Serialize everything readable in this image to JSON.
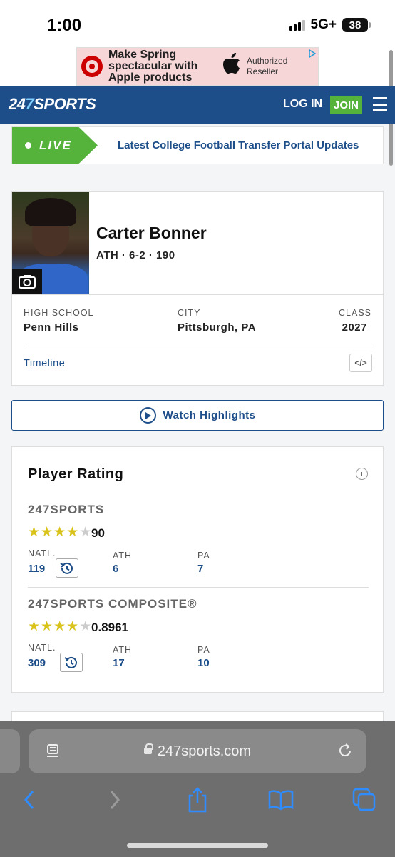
{
  "status_bar": {
    "time": "1:00",
    "network": "5G+",
    "battery": "38"
  },
  "ad": {
    "headline": "Make Spring spectacular with Apple products",
    "reseller": "Authorized Reseller",
    "choice_icon": "ad-choices-icon",
    "brand_color": "#cc0000"
  },
  "header": {
    "logo_prefix": "24",
    "logo_seven": "7",
    "logo_suffix": "SPORTS",
    "login": "LOG IN",
    "join": "JOIN",
    "menu_icon": "hamburger-icon",
    "color": "#1d4e89"
  },
  "live": {
    "badge": "LIVE",
    "headline": "Latest College Football Transfer Portal Updates",
    "color": "#55b33b"
  },
  "player": {
    "name": "Carter Bonner",
    "meta": "ATH · 6-2 · 190",
    "high_school_label": "HIGH SCHOOL",
    "high_school": "Penn Hills",
    "city_label": "CITY",
    "city": "Pittsburgh, PA",
    "class_label": "CLASS",
    "class": "2027",
    "timeline": "Timeline",
    "embed": "</>"
  },
  "highlights": {
    "label": "Watch Highlights"
  },
  "rating": {
    "title": "Player Rating",
    "info": "i",
    "sources": [
      {
        "name": "247SPORTS",
        "stars": 4,
        "score": "90",
        "natl_label": "NATL.",
        "natl": "119",
        "pos_label": "ATH",
        "pos": "6",
        "state_label": "PA",
        "state": "7"
      },
      {
        "name": "247SPORTS COMPOSITE®",
        "stars": 4,
        "score": "0.8961",
        "natl_label": "NATL.",
        "natl": "309",
        "pos_label": "ATH",
        "pos": "17",
        "state_label": "PA",
        "state": "10"
      }
    ]
  },
  "browser": {
    "url": "247sports.com"
  }
}
